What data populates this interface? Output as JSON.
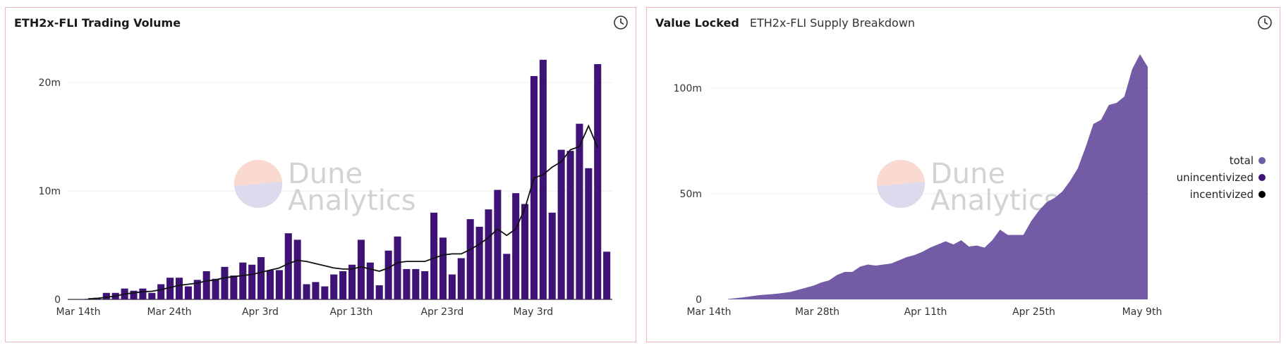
{
  "panels": [
    {
      "title": "ETH2x-FLI Trading Volume",
      "subtitle": "",
      "clock_icon": "clock-icon"
    },
    {
      "title": "Value Locked",
      "subtitle": "ETH2x-FLI Supply Breakdown",
      "clock_icon": "clock-icon"
    }
  ],
  "watermark": {
    "line1": "Dune",
    "line2": "Analytics"
  },
  "chart_data": [
    {
      "type": "bar",
      "title": "ETH2x-FLI Trading Volume",
      "x_tick_labels": [
        "Mar 14th",
        "Mar 24th",
        "Apr 3rd",
        "Apr 13th",
        "Apr 23rd",
        "May 3rd"
      ],
      "y_tick_labels": [
        "0",
        "10m",
        "20m"
      ],
      "y_tick_values": [
        0,
        10,
        20
      ],
      "ylim": [
        0,
        23
      ],
      "unit": "millions",
      "x_start_date": "Mar 14th",
      "series": [
        {
          "type": "bar",
          "color": "#3f1376",
          "values": [
            0.05,
            0.15,
            0.6,
            0.6,
            1.0,
            0.8,
            1.0,
            0.6,
            1.4,
            2.0,
            2.0,
            1.2,
            1.8,
            2.6,
            1.9,
            3.0,
            2.2,
            3.4,
            3.2,
            3.9,
            2.7,
            2.7,
            6.1,
            5.5,
            1.4,
            1.6,
            1.2,
            2.3,
            2.6,
            3.2,
            5.5,
            3.4,
            1.3,
            4.5,
            5.8,
            2.8,
            2.8,
            2.6,
            8.0,
            5.7,
            2.3,
            3.8,
            7.4,
            6.7,
            8.3,
            10.1,
            4.2,
            9.8,
            8.8,
            20.6,
            22.1,
            8.0,
            13.8,
            13.7,
            16.2,
            12.1,
            21.7,
            4.4
          ]
        },
        {
          "type": "line",
          "color": "#111111",
          "values": [
            0.05,
            0.1,
            0.2,
            0.3,
            0.5,
            0.6,
            0.7,
            0.75,
            0.9,
            1.1,
            1.3,
            1.4,
            1.5,
            1.7,
            1.8,
            2.0,
            2.1,
            2.2,
            2.3,
            2.5,
            2.7,
            2.9,
            3.3,
            3.6,
            3.5,
            3.3,
            3.1,
            2.9,
            2.8,
            2.8,
            3.0,
            2.8,
            2.6,
            2.9,
            3.4,
            3.5,
            3.5,
            3.5,
            3.8,
            4.1,
            4.2,
            4.2,
            4.6,
            5.1,
            5.7,
            6.5,
            5.9,
            6.5,
            8.4,
            11.2,
            11.5,
            12.2,
            12.7,
            13.8,
            14.1,
            16.0,
            14.0
          ]
        }
      ],
      "grid": true
    },
    {
      "type": "area",
      "title": "Value Locked",
      "subtitle": "ETH2x-FLI Supply Breakdown",
      "x_tick_labels": [
        "Mar 14th",
        "Mar 28th",
        "Apr 11th",
        "Apr 25th",
        "May 9th"
      ],
      "y_tick_labels": [
        "0",
        "50m",
        "100m"
      ],
      "y_tick_values": [
        0,
        50,
        100
      ],
      "ylim": [
        0,
        118
      ],
      "unit": "millions",
      "legend": [
        {
          "name": "total",
          "color": "#6c5ea8"
        },
        {
          "name": "unincentivized",
          "color": "#3f1376"
        },
        {
          "name": "incentivized",
          "color": "#000000"
        }
      ],
      "legend_position": "right",
      "series": [
        {
          "name": "total",
          "color": "#735ca5",
          "values": [
            0.2,
            0.6,
            1.0,
            1.5,
            2.0,
            2.3,
            2.6,
            3.0,
            3.5,
            4.5,
            5.5,
            6.5,
            8.0,
            9.0,
            11.5,
            13.0,
            13.0,
            15.5,
            16.5,
            16.0,
            16.5,
            17.0,
            18.5,
            20.0,
            21.0,
            22.5,
            24.5,
            26.0,
            27.5,
            26.0,
            28.0,
            25.0,
            25.5,
            24.5,
            28.0,
            33.0,
            30.5,
            30.5,
            30.5,
            37.0,
            42.0,
            46.0,
            48.0,
            51.0,
            56.0,
            62.0,
            72.0,
            83.0,
            85.0,
            92.0,
            93.0,
            96.0,
            109.0,
            116.0,
            110.0
          ]
        }
      ],
      "grid": true
    }
  ]
}
